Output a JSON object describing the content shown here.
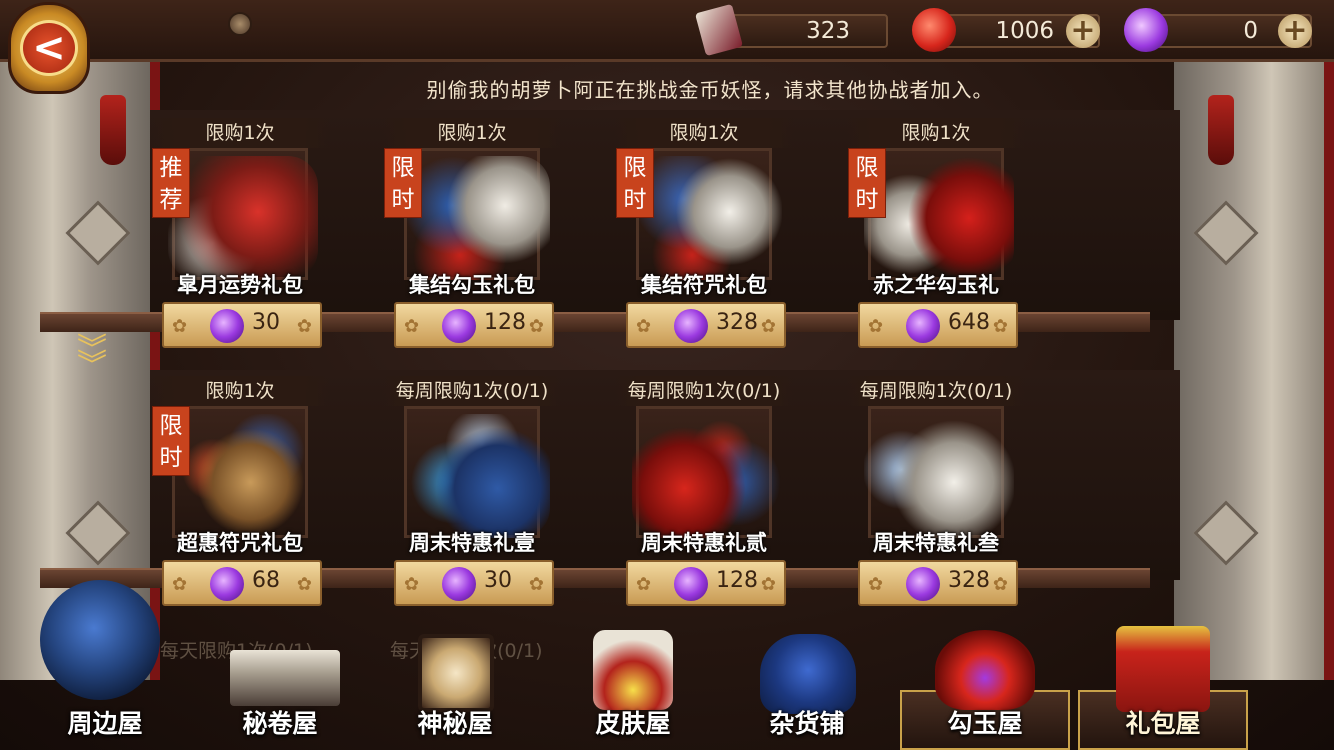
{
  "header": {
    "resources": [
      {
        "id": "skin-voucher",
        "value": "323",
        "has_plus": false
      },
      {
        "id": "magatama",
        "value": "1006",
        "has_plus": true
      },
      {
        "id": "purple-jade",
        "value": "0",
        "has_plus": true
      }
    ],
    "back_glyph": "<"
  },
  "notice": "别偷我的胡萝卜阿正在挑战金币妖怪，请求其他协战者加入。",
  "shop": {
    "rows": [
      [
        {
          "limit": "限购1次",
          "tag": "推荐",
          "name": "皐月运势礼包",
          "price": "30"
        },
        {
          "limit": "限购1次",
          "tag": "限时",
          "name": "集结勾玉礼包",
          "price": "128"
        },
        {
          "limit": "限购1次",
          "tag": "限时",
          "name": "集结符咒礼包",
          "price": "328"
        },
        {
          "limit": "限购1次",
          "tag": "限时",
          "name": "赤之华勾玉礼",
          "price": "648"
        }
      ],
      [
        {
          "limit": "限购1次",
          "tag": "限时",
          "name": "超惠符咒礼包",
          "price": "68"
        },
        {
          "limit": "每周限购1次(0/1)",
          "tag": "",
          "name": "周末特惠礼壹",
          "price": "30"
        },
        {
          "limit": "每周限购1次(0/1)",
          "tag": "",
          "name": "周末特惠礼贰",
          "price": "128"
        },
        {
          "limit": "每周限购1次(0/1)",
          "tag": "",
          "name": "周末特惠礼叁",
          "price": "328"
        }
      ]
    ],
    "faded_row": [
      "每天限购1次(0/1)",
      "每天限购1次(0/1)"
    ]
  },
  "nav": {
    "tabs": [
      {
        "label": "周边屋",
        "active": false
      },
      {
        "label": "秘卷屋",
        "active": false
      },
      {
        "label": "神秘屋",
        "active": false
      },
      {
        "label": "皮肤屋",
        "active": false
      },
      {
        "label": "杂货铺",
        "active": false
      },
      {
        "label": "勾玉屋",
        "active": false
      },
      {
        "label": "礼包屋",
        "active": true
      }
    ]
  },
  "colors": {
    "accent_gold": "#c99b54",
    "tag_red": "#c8431d",
    "jade_purple": "#9b3ae0",
    "magatama_red": "#d7261c"
  }
}
